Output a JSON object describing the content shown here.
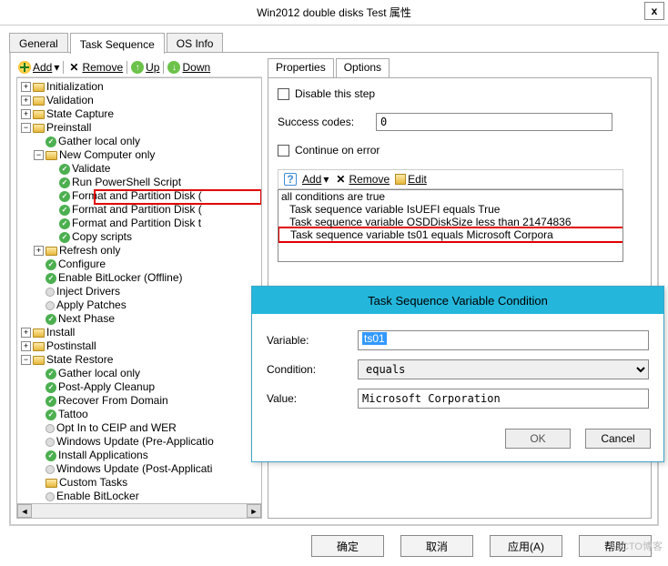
{
  "window": {
    "title": "Win2012 double disks Test 属性",
    "close_label": "x"
  },
  "tabs": {
    "general": "General",
    "task_sequence": "Task Sequence",
    "os_info": "OS Info"
  },
  "left_toolbar": {
    "add": "Add",
    "remove": "Remove",
    "up": "Up",
    "down": "Down"
  },
  "tree": {
    "initialization": "Initialization",
    "validation": "Validation",
    "state_capture": "State Capture",
    "preinstall": "Preinstall",
    "gather_local": "Gather local only",
    "new_computer": "New Computer only",
    "validate": "Validate",
    "run_ps": "Run PowerShell Script",
    "fpd1": "Format and Partition Disk (",
    "fpd_sel": "Format and Partition Disk (",
    "fpd2": "Format and Partition Disk t",
    "copy_scripts": "Copy scripts",
    "refresh_only": "Refresh only",
    "configure": "Configure",
    "enable_bl_off": "Enable BitLocker (Offline)",
    "inject_drivers": "Inject Drivers",
    "apply_patches": "Apply Patches",
    "next_phase": "Next Phase",
    "install": "Install",
    "postinstall": "Postinstall",
    "state_restore": "State Restore",
    "gather_local2": "Gather local only",
    "post_apply": "Post-Apply Cleanup",
    "recover_domain": "Recover From Domain",
    "tattoo": "Tattoo",
    "opt_in": "Opt In to CEIP and WER",
    "wu_pre": "Windows Update (Pre-Applicatio",
    "install_apps": "Install Applications",
    "wu_post": "Windows Update (Post-Applicati",
    "custom_tasks": "Custom Tasks",
    "enable_bl": "Enable BitLocker"
  },
  "right": {
    "tab_properties": "Properties",
    "tab_options": "Options",
    "disable_step": "Disable this step",
    "success_codes_label": "Success codes:",
    "success_codes_value": "0",
    "continue_on_error": "Continue on error",
    "cond_add": "Add",
    "cond_remove": "Remove",
    "cond_edit": "Edit",
    "conds": [
      "all conditions are true",
      "Task sequence variable IsUEFI equals True",
      "Task sequence variable OSDDiskSize less than 21474836",
      "Task sequence variable ts01 equals Microsoft Corpora"
    ]
  },
  "dialog": {
    "title": "Task Sequence Variable Condition",
    "variable_label": "Variable:",
    "variable_value": "ts01",
    "condition_label": "Condition:",
    "condition_value": "equals",
    "value_label": "Value:",
    "value_value": "Microsoft Corporation",
    "ok": "OK",
    "cancel": "Cancel"
  },
  "footer": {
    "ok": "确定",
    "cancel": "取消",
    "apply": "应用(A)",
    "help": "帮助"
  },
  "watermark": "51CTO博客"
}
